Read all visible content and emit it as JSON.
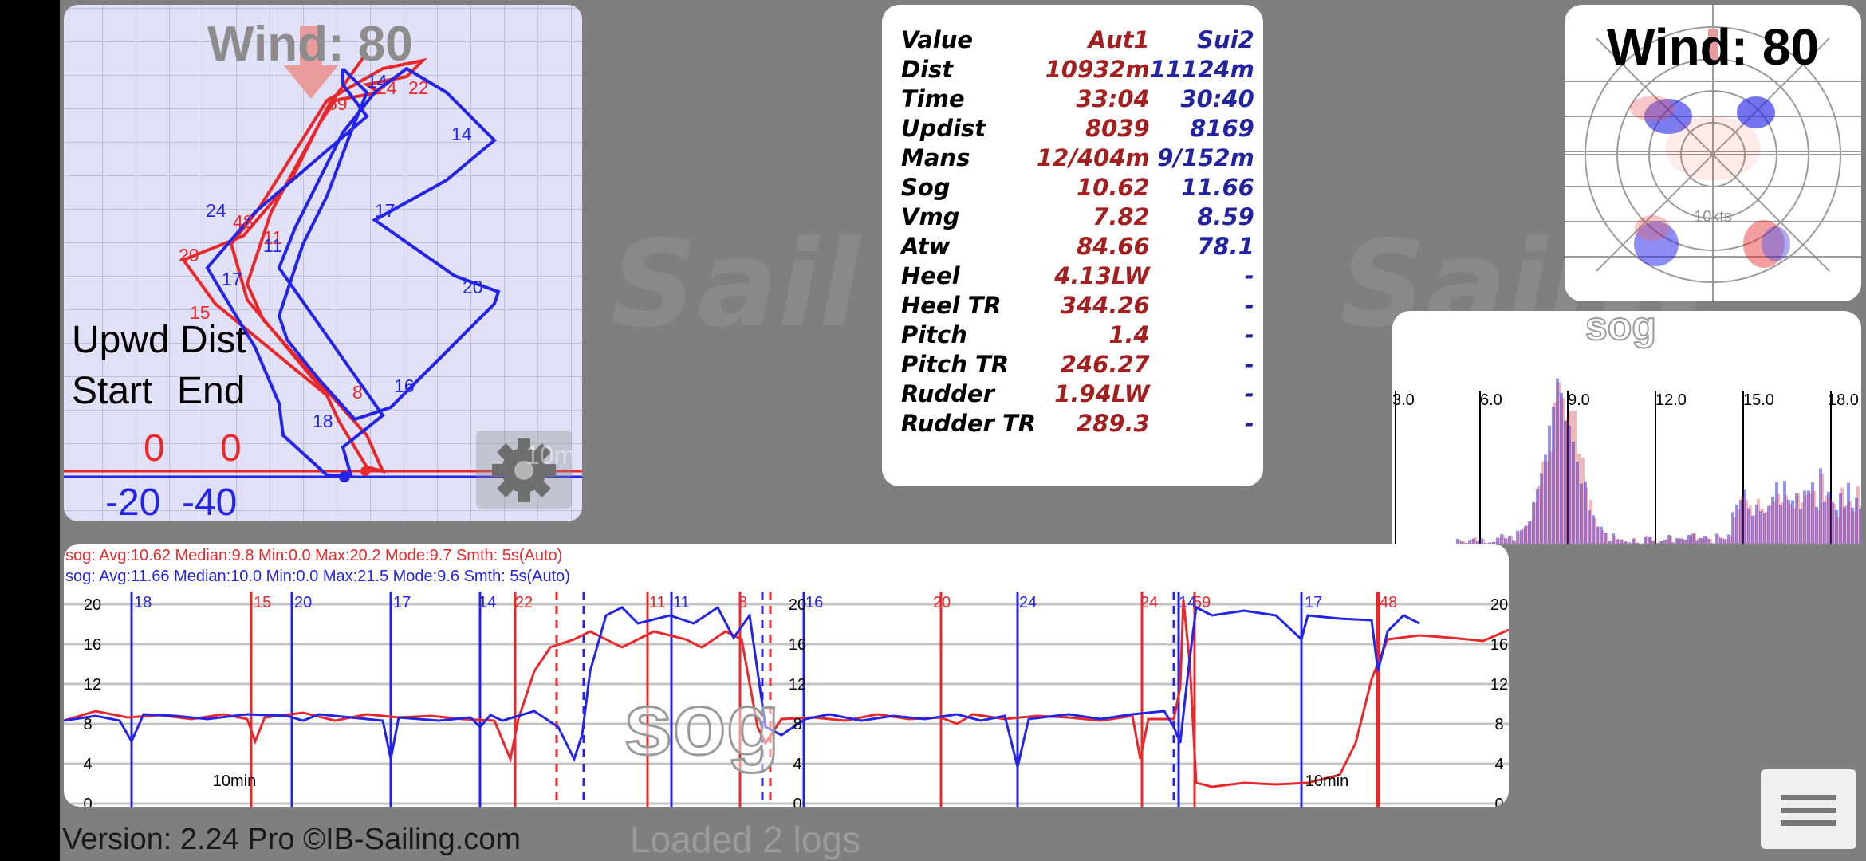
{
  "track": {
    "wind_label": "Wind: 80",
    "upwd_dist_label": "Upwd Dist",
    "start_label": "Start",
    "end_label": "End",
    "start_val": "0",
    "end_val": "0",
    "grid_left": "-20",
    "grid_right": "-40",
    "gear_overlay_text": "10m",
    "red_labels": [
      "59",
      "24",
      "22",
      "48",
      "11",
      "20",
      "15",
      "8"
    ],
    "blue_labels": [
      "14",
      "14",
      "17",
      "24",
      "11",
      "17",
      "20",
      "16",
      "18"
    ]
  },
  "stats": {
    "header": {
      "key": "Value",
      "a": "Aut1",
      "b": "Sui2"
    },
    "rows": [
      {
        "k": "Dist",
        "a": "10932m",
        "b": "11124m"
      },
      {
        "k": "Time",
        "a": "33:04",
        "b": "30:40"
      },
      {
        "k": "Updist",
        "a": "8039",
        "b": "8169"
      },
      {
        "k": "Mans",
        "a": "12/404m",
        "b": "9/152m"
      },
      {
        "k": "Sog",
        "a": "10.62",
        "b": "11.66"
      },
      {
        "k": "Vmg",
        "a": "7.82",
        "b": "8.59"
      },
      {
        "k": "Atw",
        "a": "84.66",
        "b": "78.1"
      },
      {
        "k": "Heel",
        "a": "4.13LW",
        "b": "-"
      },
      {
        "k": "Heel TR",
        "a": "344.26",
        "b": "-"
      },
      {
        "k": "Pitch",
        "a": "1.4",
        "b": "-"
      },
      {
        "k": "Pitch TR",
        "a": "246.27",
        "b": "-"
      },
      {
        "k": "Rudder",
        "a": "1.94LW",
        "b": "-"
      },
      {
        "k": "Rudder TR",
        "a": "289.3",
        "b": "-"
      }
    ]
  },
  "polar": {
    "wind_label": "Wind: 80",
    "ring_label": "10kts"
  },
  "histogram": {
    "title": "sog",
    "ticks": [
      "3.0",
      "6.0",
      "9.0",
      "12.0",
      "15.0",
      "18.0"
    ]
  },
  "sog_panel": {
    "summary_red": "sog:  Avg:10.62 Median:9.8 Min:0.0 Max:20.2 Mode:9.7 Smth: 5s(Auto)",
    "summary_blue": "sog:  Avg:11.66 Median:10.0 Min:0.0 Max:21.5 Mode:9.6 Smth: 5s(Auto)",
    "watermark": "sog",
    "y_ticks": [
      "20",
      "16",
      "12",
      "8",
      "4",
      "0"
    ],
    "time_label": "10min",
    "left_blue_marks": [
      "18",
      "20",
      "17",
      "14"
    ],
    "left_red_marks": [
      "15",
      "22",
      "11",
      "11",
      "8"
    ],
    "right_blue_marks": [
      "16",
      "24",
      "14",
      "17"
    ],
    "right_red_marks": [
      "20",
      "24",
      "59",
      "48"
    ]
  },
  "footer": {
    "version": "Version: 2.24 Pro ©IB-Sailing.com",
    "loaded": "Loaded 2 logs"
  },
  "colors": {
    "red": "#e8282a",
    "blue": "#2424e6",
    "stat_red": "#a32020",
    "stat_blue": "#22239f"
  },
  "icons": {
    "gear": "gear-icon",
    "menu": "hamburger-menu-icon",
    "wind_arrow": "wind-arrow-icon"
  }
}
